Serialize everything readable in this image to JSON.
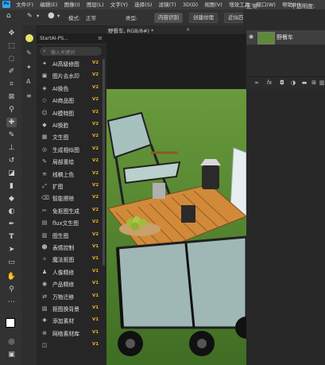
{
  "menubar": {
    "ps_logo": "Ps",
    "items": [
      "文件(F)",
      "编辑(E)",
      "图像(I)",
      "图层(L)",
      "文字(Y)",
      "选择(S)",
      "滤镜(T)",
      "3D(D)",
      "视图(V)",
      "增效工具",
      "窗口(W)",
      "帮助(H)"
    ]
  },
  "options": {
    "mode_label": "模式:",
    "mode_value": "正常",
    "type_label": "类型:",
    "content_aware": "内容识别",
    "create_texture": "创建纹理",
    "nearby_match": "近似匹配",
    "blend_value": "正常",
    "opacity_label": "不透明度:"
  },
  "document": {
    "tab_title": "野餐车, RGB/8#) *"
  },
  "plugin": {
    "title": "StartAI-PS...",
    "search_placeholder": "输入关键词",
    "items": [
      {
        "icon": "sparkle-icon",
        "glyph": "✦",
        "label": "AI高级修图",
        "badge": "V2"
      },
      {
        "icon": "image-remove-icon",
        "glyph": "▣",
        "label": "图片去水印",
        "badge": "V2"
      },
      {
        "icon": "color-swap-icon",
        "glyph": "◈",
        "label": "AI换色",
        "badge": "V2"
      },
      {
        "icon": "product-image-icon",
        "glyph": "◇",
        "label": "AI商品图",
        "badge": "V2"
      },
      {
        "icon": "model-image-icon",
        "glyph": "☺",
        "label": "AI模特图",
        "badge": "V2"
      },
      {
        "icon": "outfit-icon",
        "glyph": "◆",
        "label": "AI换脸",
        "badge": "V2"
      },
      {
        "icon": "text-to-image-icon",
        "glyph": "▦",
        "label": "文生图",
        "badge": "V2"
      },
      {
        "icon": "similar-image-icon",
        "glyph": "◎",
        "label": "生成相似图",
        "badge": "V2"
      },
      {
        "icon": "redraw-icon",
        "glyph": "✎",
        "label": "局部重绘",
        "badge": "V2"
      },
      {
        "icon": "line-art-icon",
        "glyph": "≋",
        "label": "线稿上色",
        "badge": "V2"
      },
      {
        "icon": "expand-icon",
        "glyph": "⤢",
        "label": "扩图",
        "badge": "V2"
      },
      {
        "icon": "smart-erase-icon",
        "glyph": "⌫",
        "label": "智能擦除",
        "badge": "V2"
      },
      {
        "icon": "cutout-icon",
        "glyph": "✂",
        "label": "免抠图生成",
        "badge": "V2"
      },
      {
        "icon": "flux-icon",
        "glyph": "▤",
        "label": "flux文生图",
        "badge": "V2"
      },
      {
        "icon": "image-gen-icon",
        "glyph": "▥",
        "label": "图生图",
        "badge": "V2"
      },
      {
        "icon": "expression-icon",
        "glyph": "☻",
        "label": "表情控制",
        "badge": "V1"
      },
      {
        "icon": "magic-cutout-icon",
        "glyph": "✧",
        "label": "魔法抠图",
        "badge": "V1"
      },
      {
        "icon": "portrait-icon",
        "glyph": "♟",
        "label": "人像精修",
        "badge": "V1"
      },
      {
        "icon": "product-retouch-icon",
        "glyph": "◉",
        "label": "产品精修",
        "badge": "V1"
      },
      {
        "icon": "transfer-icon",
        "glyph": "⇄",
        "label": "万物迁移",
        "badge": "V1"
      },
      {
        "icon": "background-icon",
        "glyph": "▧",
        "label": "抠图换背景",
        "badge": "V1"
      },
      {
        "icon": "material-add-icon",
        "glyph": "✚",
        "label": "添加素材",
        "badge": "V1"
      },
      {
        "icon": "web-material-icon",
        "glyph": "⊕",
        "label": "网络素材库",
        "badge": "V1"
      },
      {
        "icon": "asset-icon",
        "glyph": "◫",
        "label": "",
        "badge": "V1"
      }
    ]
  },
  "layers": {
    "layer_name": "野餐车"
  },
  "colors": {
    "accent": "#31a8ff",
    "badge": "#f0b323",
    "grass": "#4a7a2a"
  }
}
